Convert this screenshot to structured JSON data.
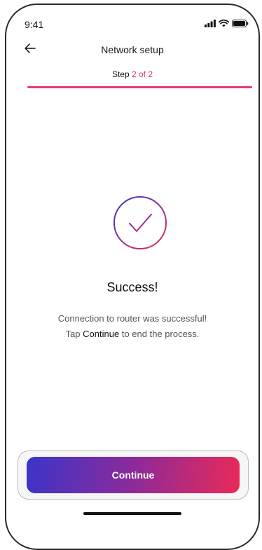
{
  "status_bar": {
    "time": "9:41",
    "icons": [
      "cellular-signal-icon",
      "wifi-icon",
      "battery-icon"
    ]
  },
  "header": {
    "back_icon": "arrow-left-icon",
    "title": "Network setup"
  },
  "step": {
    "prefix": "Step",
    "current": "2",
    "of_label": "of",
    "total": "2",
    "progress_fraction": 1.0
  },
  "result": {
    "icon": "check-circle-icon",
    "title": "Success!",
    "message_line1": "Connection to router was successful!",
    "message_line2_prefix": "Tap",
    "message_line2_action": "Continue",
    "message_line2_suffix": "to end the process."
  },
  "actions": {
    "continue_label": "Continue"
  },
  "colors": {
    "accent": "#e0336a",
    "gradient_start": "#3b34c9",
    "gradient_end": "#ea2a57"
  }
}
